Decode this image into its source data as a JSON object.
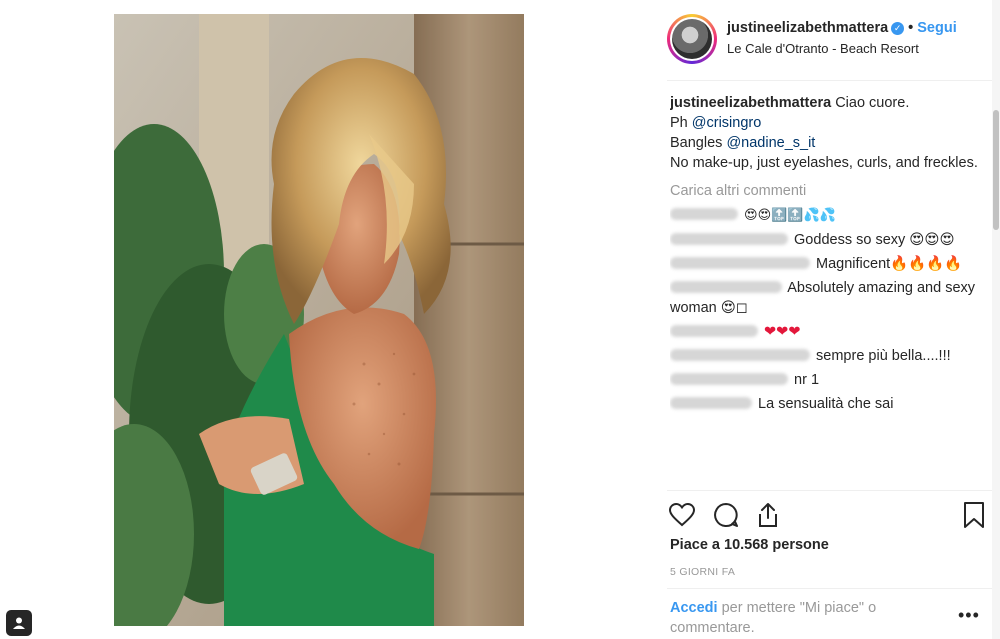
{
  "post": {
    "username": "justineelizabethmattera",
    "verified_icon": "verified-badge-icon",
    "follow_separator": "•",
    "follow_label": "Segui",
    "location": "Le Cale d'Otranto - Beach Resort",
    "caption": {
      "username": "justineelizabethmattera",
      "line1": "Ciao cuore.",
      "line2_prefix": "Ph ",
      "line2_mention": "@crisingro",
      "line3_prefix": "Bangles ",
      "line3_mention": "@nadine_s_it",
      "line4": "No make-up, just eyelashes, curls, and freckles."
    },
    "load_more": "Carica altri commenti",
    "comments": [
      {
        "text": "😍😍🔝🔝💦💦"
      },
      {
        "text": "Goddess so sexy 😍😍😍"
      },
      {
        "text": "Magnificent🔥🔥🔥🔥"
      },
      {
        "text": "Absolutely amazing and sexy woman 😍◻"
      },
      {
        "text": "❤❤❤"
      },
      {
        "text": "sempre più bella....!!!"
      },
      {
        "text": "nr 1"
      },
      {
        "text": "La sensualità che sai"
      }
    ],
    "likes_text": "Piace a 10.568 persone",
    "time_ago": "5 GIORNI FA",
    "login_link": "Accedi",
    "login_suffix": " per mettere \"Mi piace\" o commentare.",
    "more_options": "•••"
  },
  "icons": {
    "like": "heart-outline-icon",
    "comment": "comment-bubble-icon",
    "share": "share-upload-icon",
    "save": "bookmark-icon",
    "corner": "person-tag-icon"
  },
  "colors": {
    "accent": "#3897f0",
    "text": "#262626",
    "muted": "#999999",
    "mention": "#003569"
  }
}
